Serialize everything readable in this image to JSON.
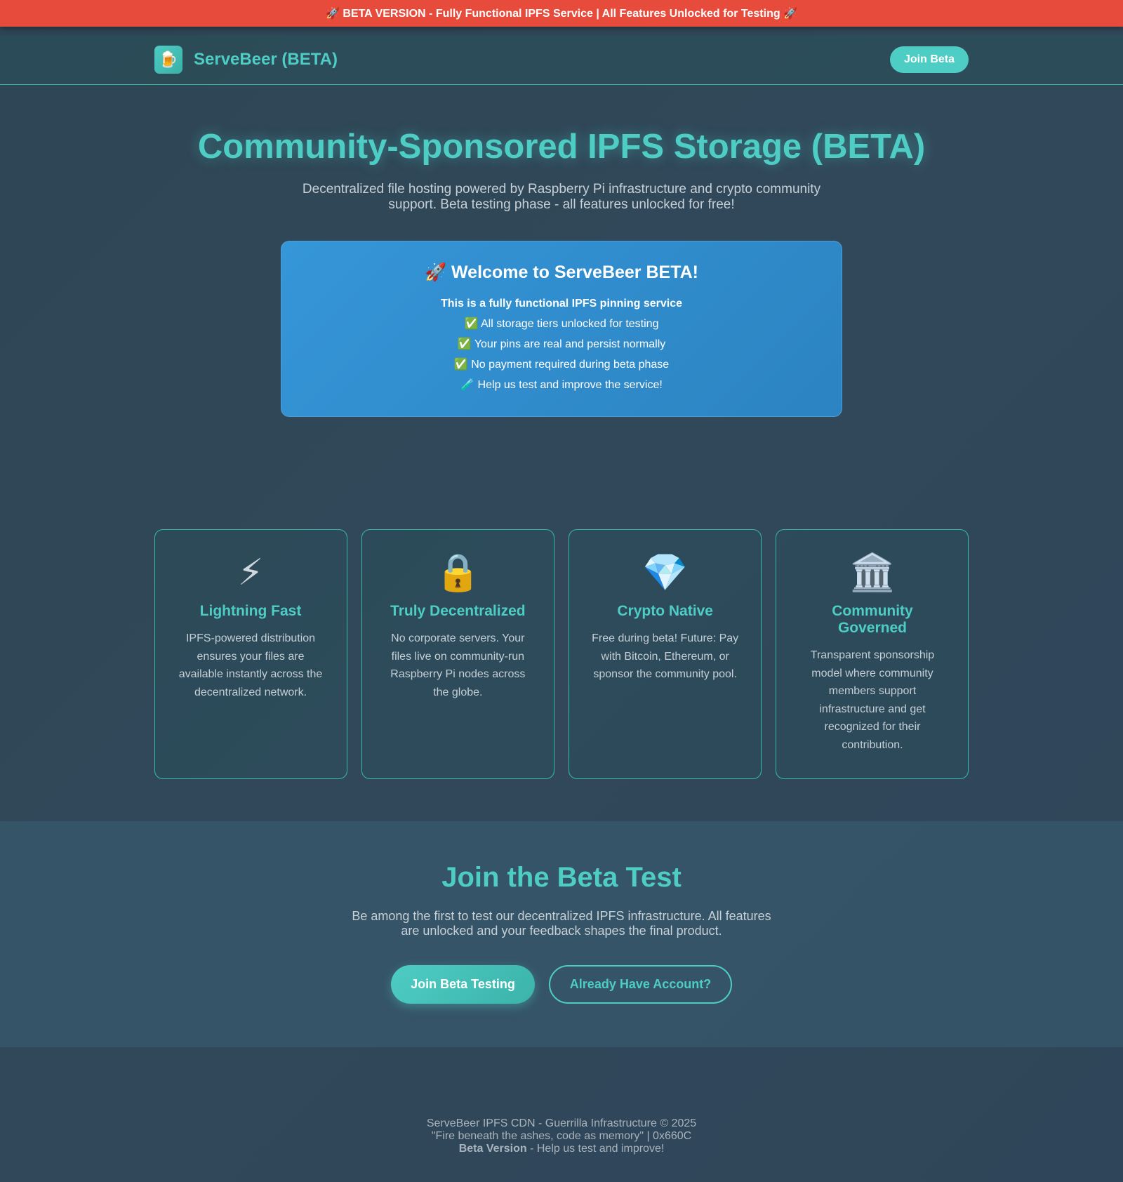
{
  "beta_banner": "🚀 BETA VERSION - Fully Functional IPFS Service | All Features Unlocked for Testing 🚀",
  "header": {
    "logo_icon": "🍺",
    "brand": "ServeBeer (BETA)",
    "join_button": "Join Beta"
  },
  "hero": {
    "title": "Community-Sponsored IPFS Storage (BETA)",
    "subtitle": "Decentralized file hosting powered by Raspberry Pi infrastructure and crypto community support. Beta testing phase - all features unlocked for free!"
  },
  "welcome": {
    "title": "🚀 Welcome to ServeBeer BETA!",
    "intro": "This is a fully functional IPFS pinning service",
    "lines": [
      "✅ All storage tiers unlocked for testing",
      "✅ Your pins are real and persist normally",
      "✅ No payment required during beta phase",
      "🧪 Help us test and improve the service!"
    ]
  },
  "features": [
    {
      "icon": "⚡",
      "icon_name": "lightning-icon",
      "title": "Lightning Fast",
      "text": "IPFS-powered distribution ensures your files are available instantly across the decentralized network."
    },
    {
      "icon": "🔒",
      "icon_name": "lock-icon",
      "title": "Truly Decentralized",
      "text": "No corporate servers. Your files live on community-run Raspberry Pi nodes across the globe."
    },
    {
      "icon": "💎",
      "icon_name": "gem-icon",
      "title": "Crypto Native",
      "text": "Free during beta! Future: Pay with Bitcoin, Ethereum, or sponsor the community pool."
    },
    {
      "icon": "🏛️",
      "icon_name": "classical-building-icon",
      "title": "Community Governed",
      "text": "Transparent sponsorship model where community members support infrastructure and get recognized for their contribution."
    }
  ],
  "cta": {
    "title": "Join the Beta Test",
    "text": "Be among the first to test our decentralized IPFS infrastructure. All features are unlocked and your feedback shapes the final product.",
    "primary_button": "Join Beta Testing",
    "secondary_button": "Already Have Account?"
  },
  "footer": {
    "line1": "ServeBeer IPFS CDN - Guerrilla Infrastructure © 2025",
    "line2": "\"Fire beneath the ashes, code as memory\" | 0x660C",
    "line3_bold": "Beta Version",
    "line3_rest": " - Help us test and improve!"
  },
  "colors": {
    "accent": "#4ecdc4",
    "banner": "#e64b3c",
    "welcome_box": "#3596d8"
  }
}
